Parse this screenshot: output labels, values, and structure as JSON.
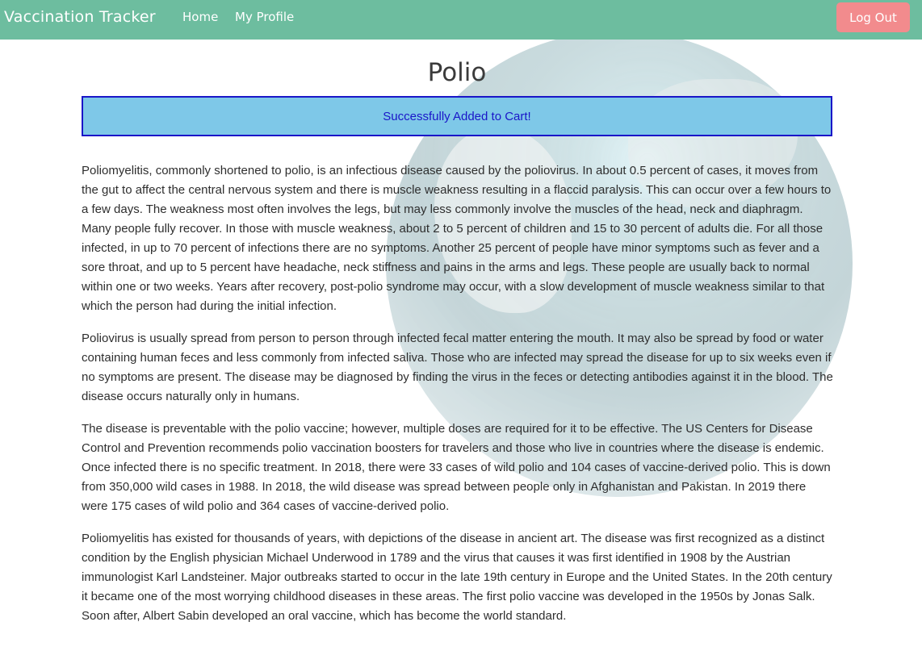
{
  "navbar": {
    "brand": "Vaccination Tracker",
    "links": [
      "Home",
      "My Profile"
    ],
    "logout_label": "Log Out"
  },
  "page": {
    "title": "Polio",
    "alert": "Successfully Added to Cart!",
    "paragraphs": [
      "Poliomyelitis, commonly shortened to polio, is an infectious disease caused by the poliovirus. In about 0.5 percent of cases, it moves from the gut to affect the central nervous system and there is muscle weakness resulting in a flaccid paralysis. This can occur over a few hours to a few days. The weakness most often involves the legs, but may less commonly involve the muscles of the head, neck and diaphragm. Many people fully recover. In those with muscle weakness, about 2 to 5 percent of children and 15 to 30 percent of adults die. For all those infected, in up to 70 percent of infections there are no symptoms. Another 25 percent of people have minor symptoms such as fever and a sore throat, and up to 5 percent have headache, neck stiffness and pains in the arms and legs. These people are usually back to normal within one or two weeks. Years after recovery, post-polio syndrome may occur, with a slow development of muscle weakness similar to that which the person had during the initial infection.",
      "Poliovirus is usually spread from person to person through infected fecal matter entering the mouth. It may also be spread by food or water containing human feces and less commonly from infected saliva. Those who are infected may spread the disease for up to six weeks even if no symptoms are present. The disease may be diagnosed by finding the virus in the feces or detecting antibodies against it in the blood. The disease occurs naturally only in humans.",
      "The disease is preventable with the polio vaccine; however, multiple doses are required for it to be effective. The US Centers for Disease Control and Prevention recommends polio vaccination boosters for travelers and those who live in countries where the disease is endemic. Once infected there is no specific treatment. In 2018, there were 33 cases of wild polio and 104 cases of vaccine-derived polio. This is down from 350,000 wild cases in 1988. In 2018, the wild disease was spread between people only in Afghanistan and Pakistan. In 2019 there were 175 cases of wild polio and 364 cases of vaccine-derived polio.",
      "Poliomyelitis has existed for thousands of years, with depictions of the disease in ancient art. The disease was first recognized as a distinct condition by the English physician Michael Underwood in 1789 and the virus that causes it was first identified in 1908 by the Austrian immunologist Karl Landsteiner. Major outbreaks started to occur in the late 19th century in Europe and the United States. In the 20th century it became one of the most worrying childhood diseases in these areas. The first polio vaccine was developed in the 1950s by Jonas Salk. Soon after, Albert Sabin developed an oral vaccine, which has become the world standard."
    ]
  },
  "colors": {
    "navbar": "#6dbd9f",
    "logout_button": "#f28b8d",
    "alert_background": "#7ec8e8",
    "alert_border": "#1a16c8"
  },
  "background_image": "globe"
}
